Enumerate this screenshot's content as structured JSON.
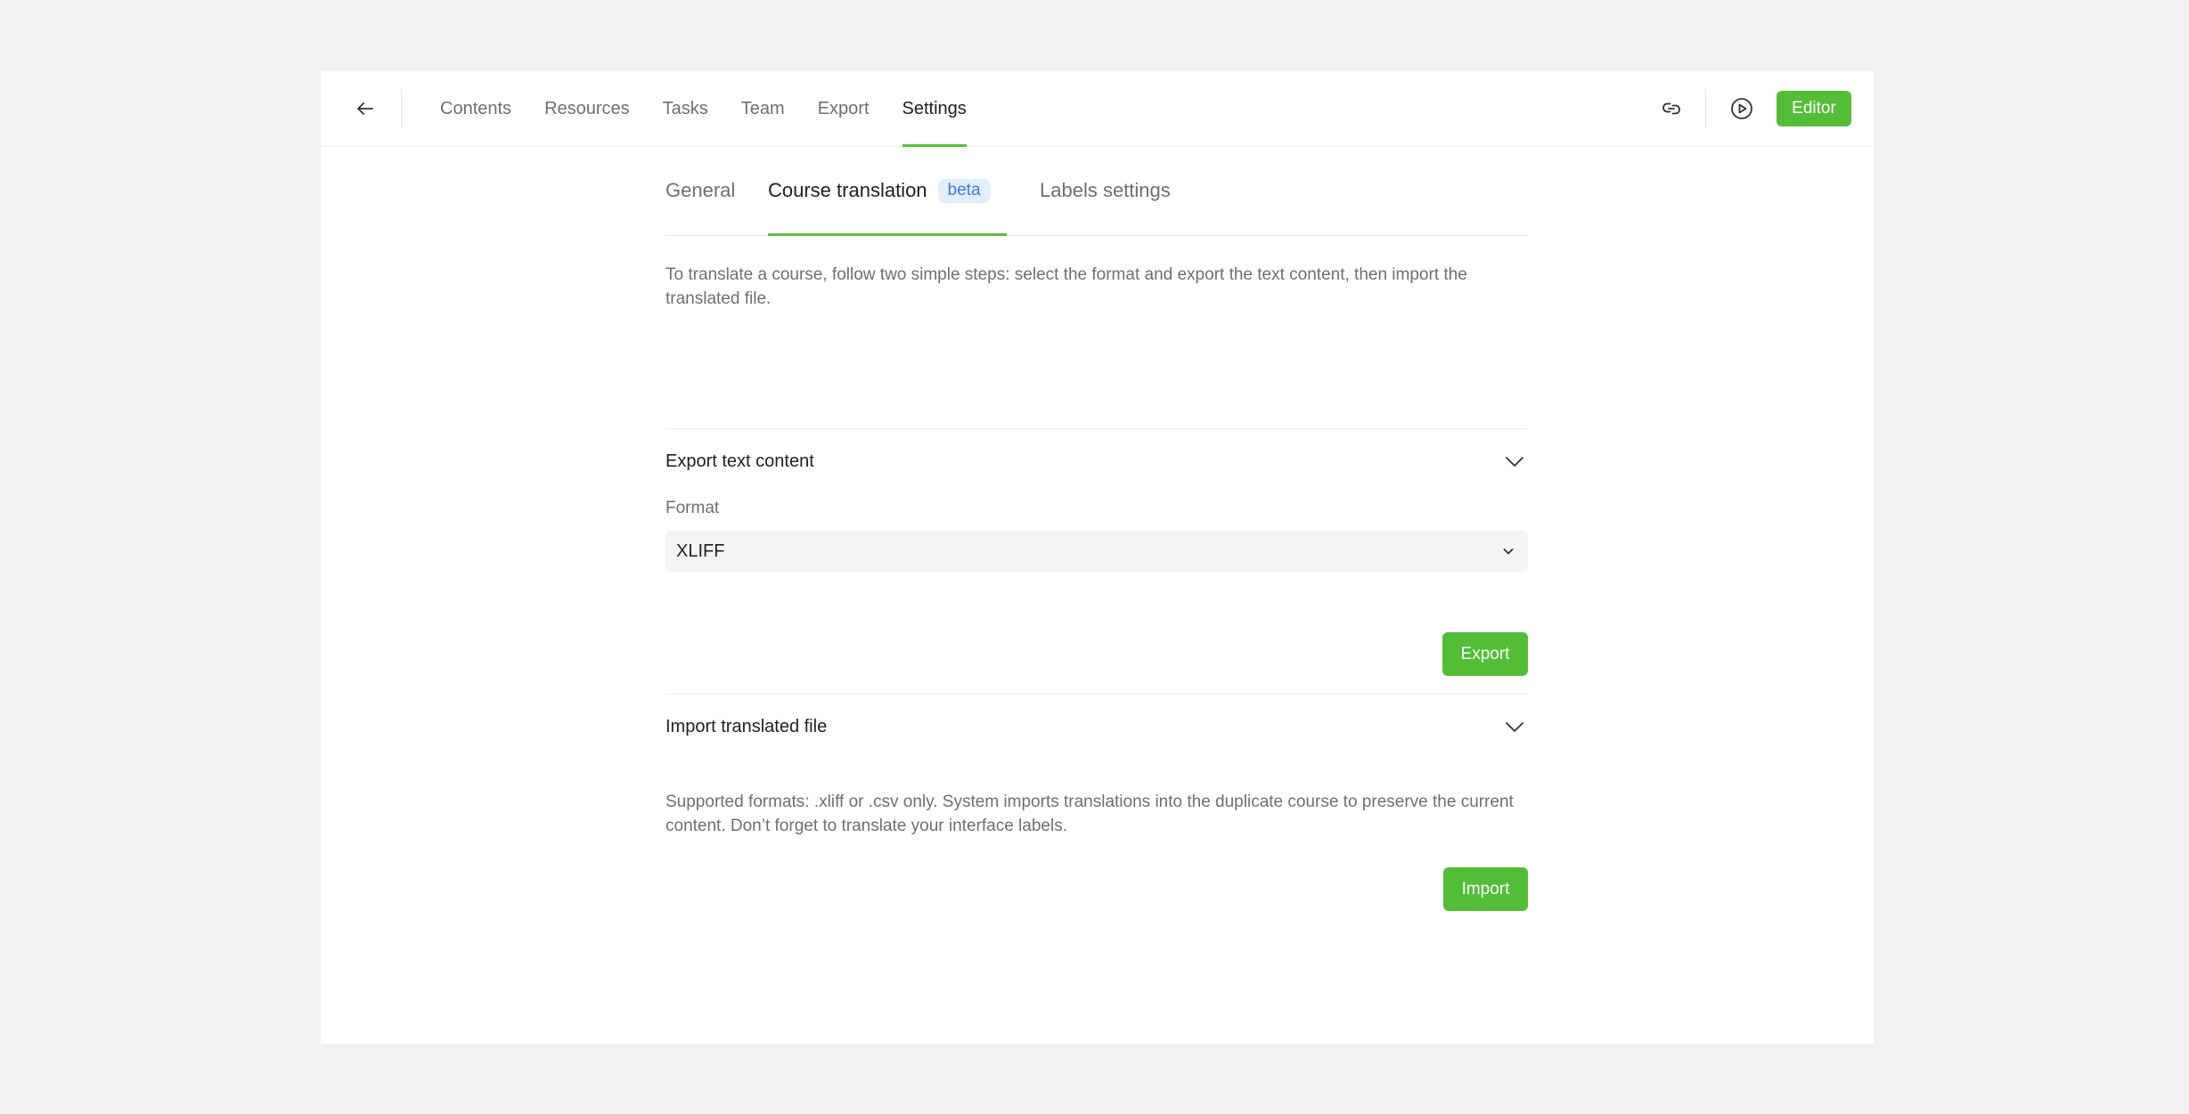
{
  "nav": {
    "back_icon": "arrow-left-icon",
    "items": [
      {
        "label": "Contents",
        "active": false
      },
      {
        "label": "Resources",
        "active": false
      },
      {
        "label": "Tasks",
        "active": false
      },
      {
        "label": "Team",
        "active": false
      },
      {
        "label": "Export",
        "active": false
      },
      {
        "label": "Settings",
        "active": true
      }
    ],
    "actions": {
      "link_icon": "link-icon",
      "preview_icon": "play-circle-icon",
      "editor_label": "Editor"
    }
  },
  "tabs": {
    "general": "General",
    "course_translation": "Course translation",
    "beta": "beta",
    "labels_settings": "Labels settings",
    "active": "course_translation"
  },
  "intro": "To translate a course, follow two simple steps: select the format and export the text content, then import the translated file.",
  "export_section": {
    "title": "Export text content",
    "expanded": true,
    "format_label": "Format",
    "format_value": "XLIFF",
    "button_label": "Export"
  },
  "import_section": {
    "title": "Import translated file",
    "expanded": true,
    "note": "Supported formats: .xliff or .csv only. System imports translations into the duplicate course to preserve the current content. Don’t forget to translate your interface labels.",
    "button_label": "Import"
  },
  "colors": {
    "accent": "#53bd38",
    "badge_bg": "#e3eefc",
    "badge_text": "#3a7be0",
    "page_bg": "#f1f1f1"
  }
}
